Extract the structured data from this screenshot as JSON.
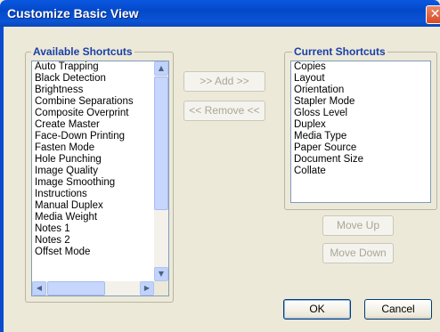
{
  "window": {
    "title": "Customize Basic View",
    "close_glyph": "✕"
  },
  "available": {
    "legend": "Available Shortcuts",
    "items": [
      "Auto Trapping",
      "Black Detection",
      "Brightness",
      "Combine Separations",
      "Composite Overprint",
      "Create Master",
      "Face-Down Printing",
      "Fasten Mode",
      "Hole Punching",
      "Image Quality",
      "Image Smoothing",
      "Instructions",
      "Manual Duplex",
      "Media Weight",
      "Notes 1",
      "Notes 2",
      "Offset Mode"
    ]
  },
  "current": {
    "legend": "Current Shortcuts",
    "items": [
      "Copies",
      "Layout",
      "Orientation",
      "Stapler Mode",
      "Gloss Level",
      "Duplex",
      "Media Type",
      "Paper Source",
      "Document Size",
      "Collate"
    ]
  },
  "buttons": {
    "add": ">> Add >>",
    "remove": "<< Remove <<",
    "move_up": "Move Up",
    "move_down": "Move Down",
    "ok": "OK",
    "cancel": "Cancel"
  },
  "scroll_glyphs": {
    "up": "▲",
    "down": "▼",
    "left": "◀",
    "right": "▶"
  },
  "colors": {
    "titlebar": "#0a58e0",
    "legend": "#1a3fa8",
    "dialog_bg": "#ece9d8"
  }
}
